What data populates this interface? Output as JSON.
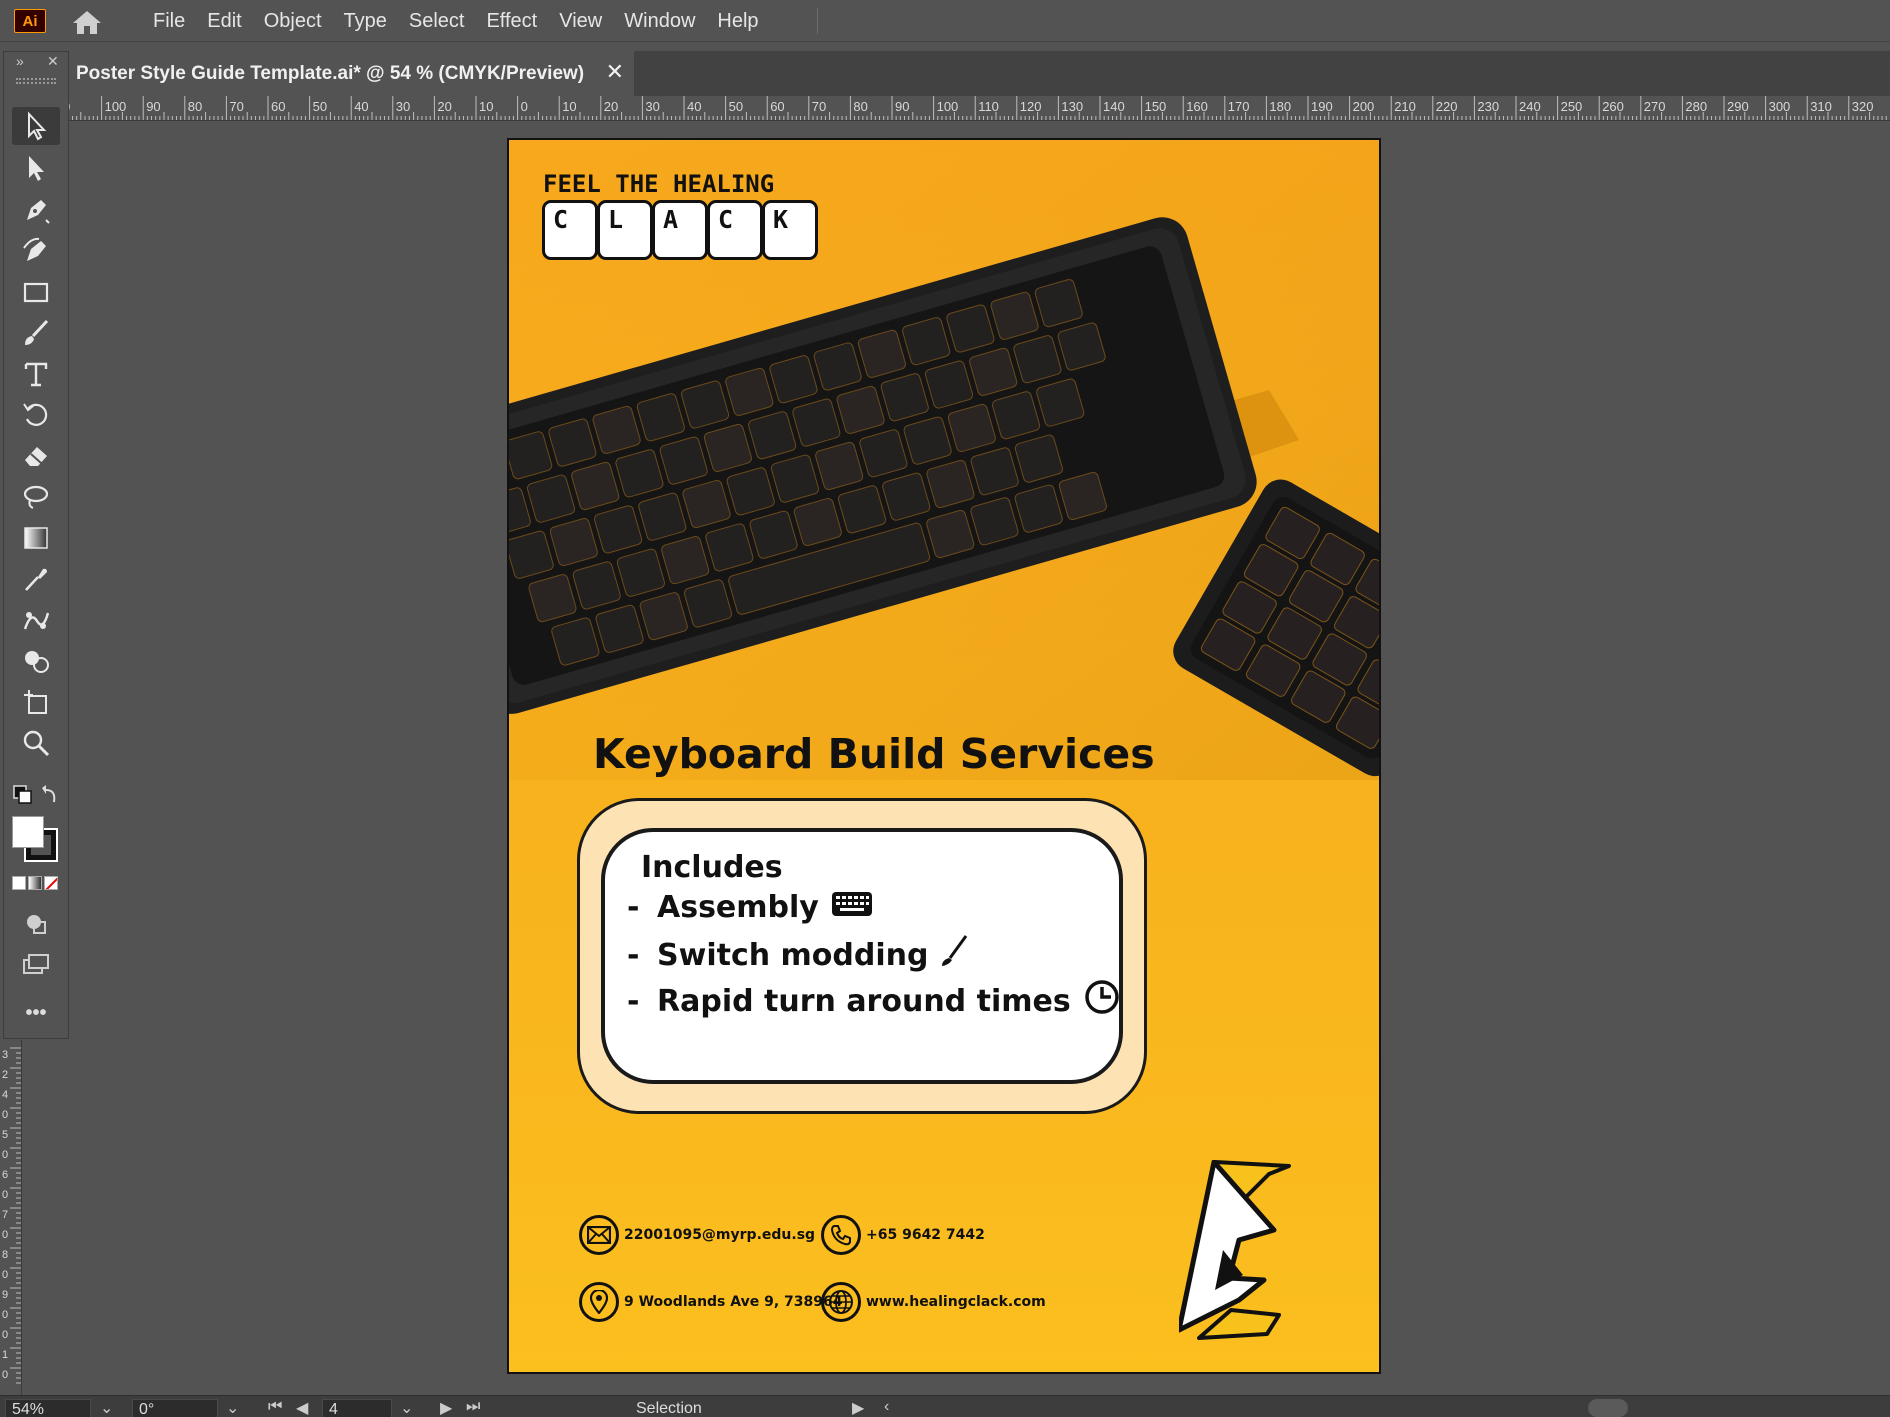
{
  "app": {
    "logo_text": "Ai"
  },
  "menu": [
    "File",
    "Edit",
    "Object",
    "Type",
    "Select",
    "Effect",
    "View",
    "Window",
    "Help"
  ],
  "document_tab": {
    "title": "Poster Style Guide Template.ai* @ 54 % (CMYK/Preview)",
    "close": "✕"
  },
  "ruler_labels": [
    "0",
    "100",
    "90",
    "80",
    "70",
    "60",
    "50",
    "40",
    "30",
    "20",
    "10",
    "0",
    "10",
    "20",
    "30",
    "40",
    "50",
    "60",
    "70",
    "80",
    "90",
    "100",
    "110",
    "120",
    "130",
    "140",
    "150",
    "160",
    "170",
    "180",
    "190",
    "200",
    "210",
    "220",
    "230",
    "240",
    "250",
    "260",
    "270",
    "280",
    "290",
    "300",
    "310",
    "320"
  ],
  "vruler_labels": [
    "3",
    "2",
    "4",
    "0",
    "5",
    "0",
    "6",
    "0",
    "7",
    "0",
    "8",
    "0",
    "9",
    "0",
    "0",
    "1",
    "0"
  ],
  "toolbar": {
    "top_glyphs": [
      "»",
      "✕"
    ],
    "tools": [
      "selection-tool",
      "direct-selection-tool",
      "pen-tool",
      "curvature-tool",
      "rectangle-tool",
      "paintbrush-tool",
      "type-tool",
      "rotate-tool",
      "eraser-tool",
      "lasso-tool",
      "gradient-tool",
      "eyedropper-tool",
      "puppet-warp-tool",
      "shape-builder-tool",
      "artboard-tool",
      "zoom-tool"
    ],
    "more": "•••"
  },
  "poster": {
    "tagline": "FEEL THE HEALING",
    "clack_letters": [
      "C",
      "L",
      "A",
      "C",
      "K"
    ],
    "title": "Keyboard Build Services",
    "includes_label": "Includes",
    "items": [
      {
        "dash": "-",
        "text": "Assembly",
        "icon": "keyboard-icon"
      },
      {
        "dash": "-",
        "text": "Switch modding",
        "icon": "brush-icon"
      },
      {
        "dash": "-",
        "text": "Rapid turn around times",
        "icon": "clock-icon"
      }
    ],
    "contacts": {
      "email": "22001095@myrp.edu.sg",
      "phone": "+65 9642 7442",
      "address": "9 Woodlands Ave 9, 738964",
      "website": "www.healingclack.com"
    },
    "colors": {
      "background": "#f8b21d",
      "box_outer": "#fde3b4",
      "box_inner": "#ffffff",
      "ink": "#111111"
    }
  },
  "statusbar": {
    "zoom": "54%",
    "rotation": "0°",
    "artboard_number": "4",
    "tool_name": "Selection"
  }
}
